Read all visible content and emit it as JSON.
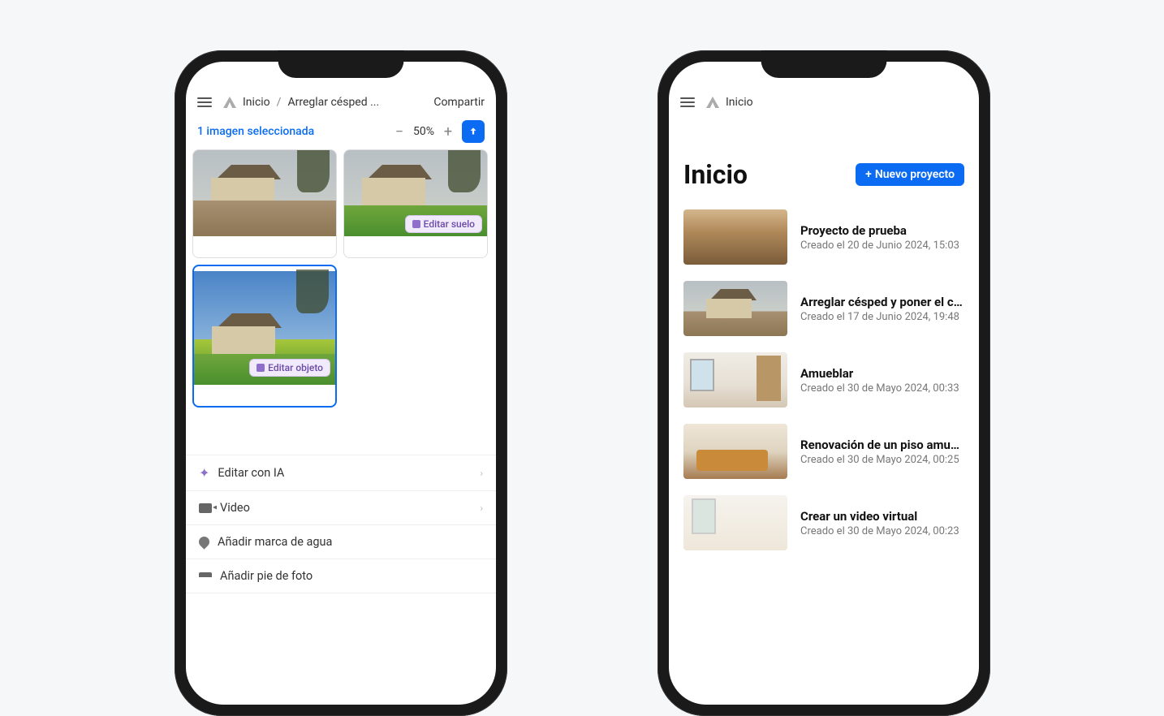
{
  "left": {
    "breadcrumb": {
      "home": "Inicio",
      "current": "Arreglar césped ..."
    },
    "share": "Compartir",
    "selection_text": "1 imagen seleccionada",
    "zoom": "50%",
    "cards": [
      {
        "badge": null
      },
      {
        "badge": "Editar suelo"
      },
      {
        "badge": "Editar objeto",
        "selected": true
      }
    ],
    "actions": {
      "ai": "Editar con IA",
      "video": "Video",
      "watermark": "Añadir marca de agua",
      "caption": "Añadir pie de foto"
    }
  },
  "right": {
    "home_label": "Inicio",
    "title": "Inicio",
    "new_project": "Nuevo proyecto",
    "projects": [
      {
        "title": "Proyecto de prueba",
        "date": "Creado el 20 de Junio 2024, 15:03"
      },
      {
        "title": "Arreglar césped y poner el cie..",
        "date": "Creado el 17 de Junio 2024, 19:48"
      },
      {
        "title": "Amueblar",
        "date": "Creado el 30 de Mayo 2024, 00:33"
      },
      {
        "title": "Renovación de un piso amueb..",
        "date": "Creado el 30 de Mayo 2024, 00:25"
      },
      {
        "title": "Crear un video virtual",
        "date": "Creado el 30 de Mayo 2024, 00:23"
      }
    ]
  }
}
